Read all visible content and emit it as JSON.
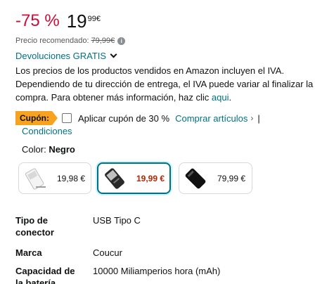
{
  "price": {
    "discount": "-75 %",
    "whole": "19",
    "fraction": "99",
    "currency": "€"
  },
  "recommended": {
    "label": "Precio recomendado:",
    "old_price": "79,99€",
    "info_icon": "info-icon"
  },
  "returns": {
    "label": "Devoluciones GRATIS",
    "icon": "chevron-down-icon"
  },
  "vat": {
    "text": "Los precios de los productos vendidos en Amazon incluyen el IVA. Dependiendo de tu dirección de entrega, el IVA puede variar al finalizar la compra. Para obtener más información, haz clic ",
    "link": "aqui",
    "end": "."
  },
  "coupon": {
    "badge": "Cupón:",
    "text": "Aplicar cupón de 30 %",
    "link": "Comprar artículos",
    "arrow": "›",
    "divider": "|",
    "conditions": "Condiciones",
    "checked": false
  },
  "color": {
    "label": "Color:",
    "value": "Negro"
  },
  "swatches": [
    {
      "price": "19,98 €",
      "selected": false,
      "variant": "white"
    },
    {
      "price": "19,99 €",
      "selected": true,
      "variant": "black-silver"
    },
    {
      "price": "79,99 €",
      "selected": false,
      "variant": "black"
    }
  ],
  "specs": [
    {
      "label": "Tipo de conector",
      "value": "USB Tipo C"
    },
    {
      "label": "Marca",
      "value": "Coucur"
    },
    {
      "label": "Capacidad de la batería",
      "value": "10000 Miliamperios hora (mAh)"
    }
  ],
  "colors": {
    "discount": "#cc0c39",
    "link": "#007185",
    "coupon_badge": "#f7a31f",
    "selected_price": "#b12704"
  }
}
